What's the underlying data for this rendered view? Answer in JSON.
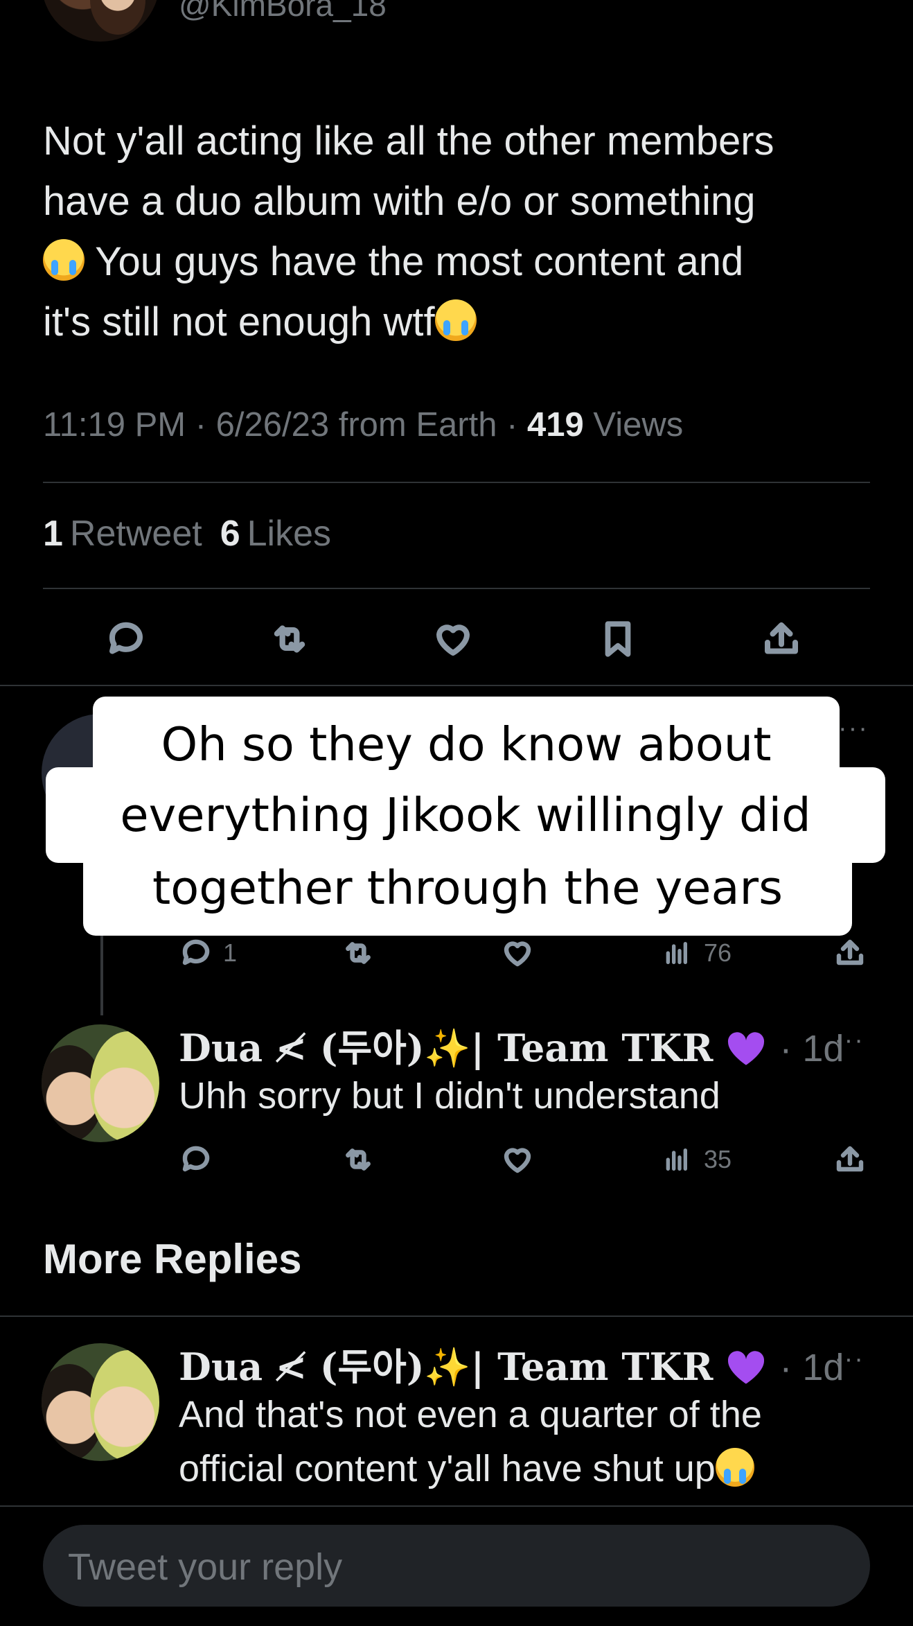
{
  "tweet": {
    "handle": "@KimBora_18",
    "text_line1": "Not y'all acting like all the other members",
    "text_line2": "have a duo album with e/o or something",
    "text_line3": "You guys have the most content and",
    "text_line4": "it's still not enough wtf",
    "time_date_source": "11:19 PM · 6/26/23 from Earth · ",
    "views_count": "419",
    "views_label": " Views",
    "retweets_count": "1",
    "retweets_label": "Retweet",
    "likes_count": "6",
    "likes_label": "Likes"
  },
  "caption": {
    "line1": "Oh so they do know about",
    "line2": "everything Jikook willingly did",
    "line3": "together through the years"
  },
  "hidden_reply": {
    "reply_count": "1",
    "views": "76"
  },
  "reply1": {
    "name": "Dua ≮ (두아)✨| Team TKR",
    "time": "· 1d",
    "text": "Uhh sorry but I didn't understand",
    "views": "35",
    "more": "···"
  },
  "section": {
    "more_replies": "More Replies"
  },
  "reply2": {
    "name": "Dua ≮ (두아)✨| Team TKR",
    "time": "· 1d",
    "text_line1": "And that's not even a quarter of the",
    "text_line2": "official content y'all have shut up",
    "more": "···"
  },
  "composer": {
    "placeholder": "Tweet your reply"
  },
  "colors": {
    "background": "#000000",
    "text": "#e7e9ea",
    "muted": "#71767b",
    "divider": "#2f3336",
    "heart_emoji": "#a44df0"
  },
  "icons": [
    "reply-icon",
    "retweet-icon",
    "like-icon",
    "bookmark-icon",
    "share-icon",
    "views-icon",
    "more-icon"
  ]
}
